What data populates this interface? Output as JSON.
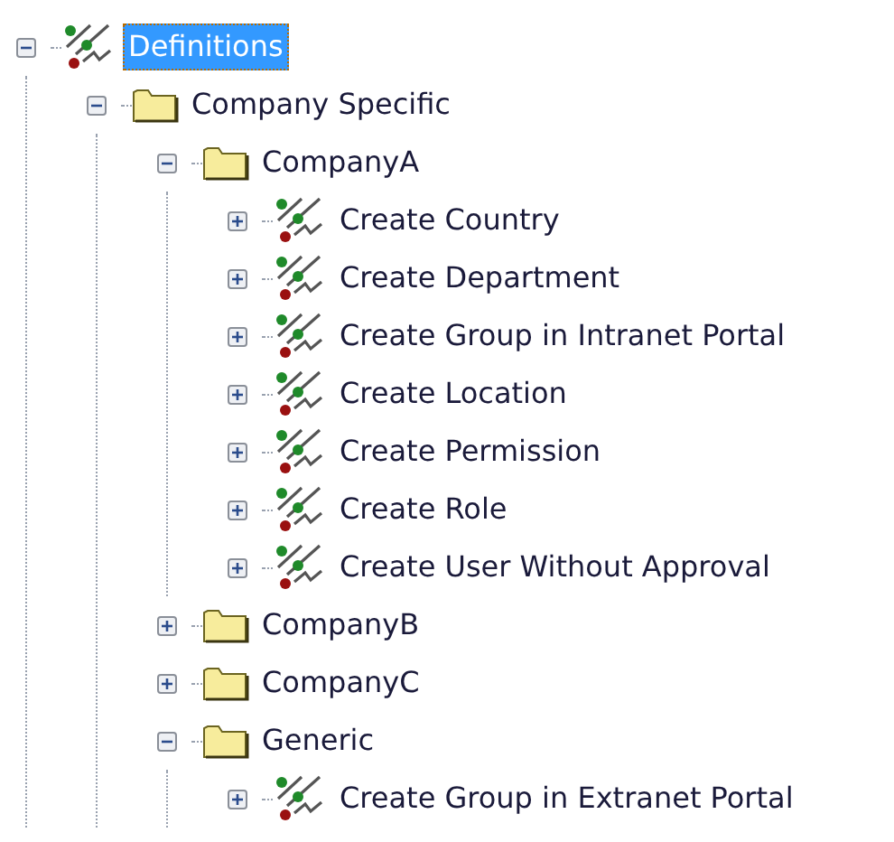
{
  "tree": [
    {
      "label": "Definitions",
      "kind": "definition",
      "selected": true,
      "expanded": true,
      "children": [
        {
          "label": "Company Specific",
          "kind": "folder",
          "selected": false,
          "expanded": true,
          "children": [
            {
              "label": "CompanyA",
              "kind": "folder",
              "selected": false,
              "expanded": true,
              "children": [
                {
                  "label": "Create Country",
                  "kind": "definition",
                  "selected": false,
                  "expanded": false
                },
                {
                  "label": "Create Department",
                  "kind": "definition",
                  "selected": false,
                  "expanded": false
                },
                {
                  "label": "Create Group in Intranet Portal",
                  "kind": "definition",
                  "selected": false,
                  "expanded": false
                },
                {
                  "label": "Create Location",
                  "kind": "definition",
                  "selected": false,
                  "expanded": false
                },
                {
                  "label": "Create Permission",
                  "kind": "definition",
                  "selected": false,
                  "expanded": false
                },
                {
                  "label": "Create Role",
                  "kind": "definition",
                  "selected": false,
                  "expanded": false
                },
                {
                  "label": "Create User Without Approval",
                  "kind": "definition",
                  "selected": false,
                  "expanded": false
                }
              ]
            },
            {
              "label": "CompanyB",
              "kind": "folder",
              "selected": false,
              "expanded": false
            },
            {
              "label": "CompanyC",
              "kind": "folder",
              "selected": false,
              "expanded": false
            },
            {
              "label": "Generic",
              "kind": "folder",
              "selected": false,
              "expanded": true,
              "children": [
                {
                  "label": "Create Group in Extranet Portal",
                  "kind": "definition",
                  "selected": false,
                  "expanded": false
                }
              ]
            }
          ]
        }
      ]
    }
  ]
}
